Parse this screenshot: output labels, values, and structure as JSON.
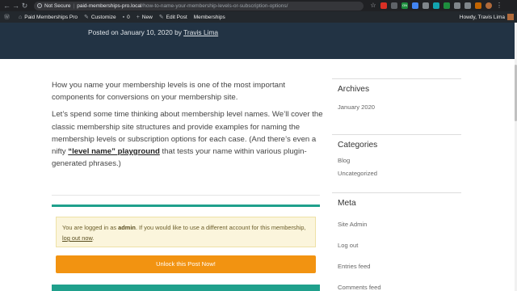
{
  "browser": {
    "security_label": "Not Secure",
    "url_domain": "paid-memberships-pro.local",
    "url_path": "/how-to-name-your-membership-levels-or-subscription-options/",
    "ext_green_label": "ON"
  },
  "adminbar": {
    "site_name": "Paid Memberships Pro",
    "customize": "Customize",
    "comments_count": "0",
    "new": "New",
    "edit_post": "Edit Post",
    "memberships": "Memberships",
    "howdy": "Howdy, Travis Lima"
  },
  "post": {
    "posted_on": "Posted on January 10, 2020 by ",
    "author": "Travis Lima",
    "para1": "How you name your membership levels is one of the most important components for conversions on your membership site.",
    "para2_before": "Let’s spend some time thinking about membership level names. We’ll cover the classic membership site structures and provide examples for naming the membership levels or subscription options for each case. (And there’s even a nifty ",
    "para2_link": "“level name” playground",
    "para2_after": " that tests your name within various plugin-generated phrases.)"
  },
  "notice": {
    "before": "You are logged in as ",
    "user": "admin",
    "middle": ". If you would like to use a different account for this membership, ",
    "logout": "log out now",
    "after": "."
  },
  "unlock_button": "Unlock this Post Now!",
  "sidebar": {
    "archives_title": "Archives",
    "archives": [
      "January 2020"
    ],
    "categories_title": "Categories",
    "categories": [
      "Blog",
      "Uncategorized"
    ],
    "meta_title": "Meta",
    "meta": [
      "Site Admin",
      "Log out",
      "Entries feed",
      "Comments feed"
    ]
  },
  "colors": {
    "header_bg": "#223344",
    "accent_teal": "#1fa08c",
    "button_orange": "#f29311",
    "adminbar_bg": "#23282d"
  }
}
